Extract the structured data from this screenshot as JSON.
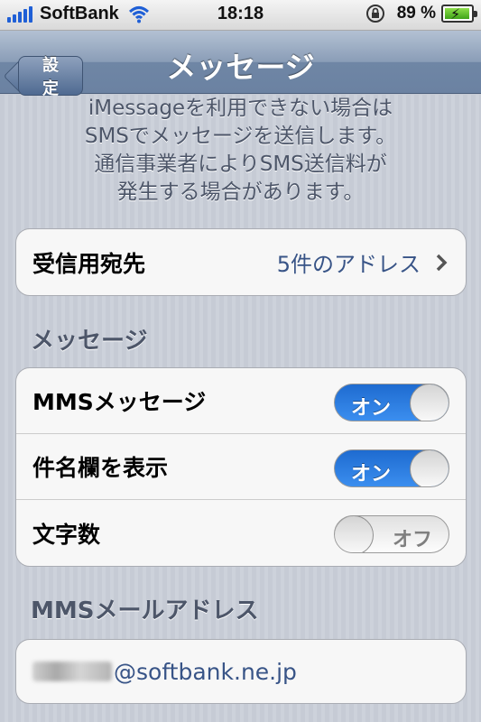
{
  "status_bar": {
    "carrier": "SoftBank",
    "time": "18:18",
    "battery_percent": "89 %",
    "battery_level": 0.89
  },
  "nav": {
    "back_label": "設定",
    "title": "メッセージ"
  },
  "footer_text": [
    "iMessageを利用できない場合は",
    "SMSでメッセージを送信します。",
    "通信事業者によりSMS送信料が",
    "発生する場合があります。"
  ],
  "receive_row": {
    "label": "受信用宛先",
    "value": "5件のアドレス"
  },
  "messages_section": {
    "header": "メッセージ",
    "rows": [
      {
        "label": "MMSメッセージ",
        "toggle": "オン",
        "state": "on"
      },
      {
        "label": "件名欄を表示",
        "toggle": "オン",
        "state": "on"
      },
      {
        "label": "文字数",
        "toggle": "オフ",
        "state": "off"
      }
    ]
  },
  "mms_section": {
    "header": "MMSメールアドレス",
    "email_suffix": "@softbank.ne.jp"
  }
}
